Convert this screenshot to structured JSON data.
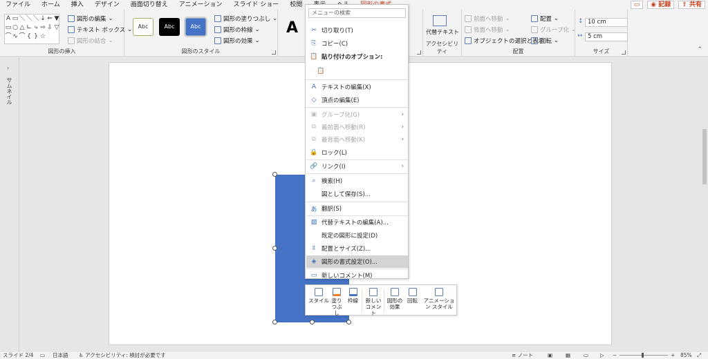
{
  "menubar": {
    "tabs": [
      "ファイル",
      "ホーム",
      "挿入",
      "デザイン",
      "画面切り替え",
      "アニメーション",
      "スライド ショー",
      "校閲",
      "表示",
      "ヘル",
      "図形の書式"
    ],
    "comment_icon": "comment-icon",
    "record": "記録",
    "share": "共有"
  },
  "ribbon": {
    "insert_shapes": {
      "shapes": [
        "A",
        "▭",
        "＼",
        "＼",
        "＼",
        "↓",
        "⇐",
        "▼",
        "▭",
        "○",
        "△",
        "∟",
        "⤷",
        "⇨",
        "⇩",
        "▽",
        "⌒",
        "∿",
        "⌒",
        "{",
        "}",
        "☆",
        "",
        ""
      ],
      "edit_shape": "図形の編集",
      "text_box": "テキスト ボックス",
      "merge_shapes": "図形の結合",
      "label": "図形の挿入"
    },
    "shape_styles": {
      "samples": [
        "Abc",
        "Abc",
        "Abc"
      ],
      "fill": "図形の塗りつぶし",
      "outline": "図形の枠線",
      "effects": "図形の効果",
      "label": "図形のスタイル"
    },
    "wordart": {
      "letter": "A"
    },
    "accessibility": {
      "alt_text": "代替テキスト",
      "label": "アクセシビリティ"
    },
    "arrange": {
      "bring_forward": "前面へ移動",
      "send_backward": "背面へ移動",
      "selection_pane": "オブジェクトの選択と表示",
      "align": "配置",
      "group": "グループ化",
      "rotate": "回転",
      "label": "配置"
    },
    "size": {
      "height": "10 cm",
      "width": "5 cm",
      "label": "サイズ"
    }
  },
  "thumbnails": {
    "label": "サムネイル",
    "toggle": "›"
  },
  "context_menu": {
    "search_placeholder": "メニューの検索",
    "items": [
      {
        "label": "切り取り(T)",
        "icon": "scissors-icon"
      },
      {
        "label": "コピー(C)",
        "icon": "copy-icon"
      },
      {
        "label": "貼り付けのオプション:",
        "icon": "paste-icon"
      },
      {
        "label": "",
        "icon": "paste-option-icon"
      },
      {
        "label": "テキストの編集(X)",
        "icon": "edit-text-icon"
      },
      {
        "label": "頂点の編集(E)",
        "icon": "edit-points-icon"
      },
      {
        "label": "グループ化(G)",
        "icon": "group-icon"
      },
      {
        "label": "最前面へ移動(R)",
        "icon": "bring-front-icon"
      },
      {
        "label": "最背面へ移動(K)",
        "icon": "send-back-icon"
      },
      {
        "label": "ロック(L)",
        "icon": "lock-icon"
      },
      {
        "label": "リンク(I)",
        "icon": "link-icon"
      },
      {
        "label": "検索(H)",
        "icon": "search-icon"
      },
      {
        "label": "図として保存(S)...",
        "icon": ""
      },
      {
        "label": "翻訳(S)",
        "icon": "translate-icon"
      },
      {
        "label": "代替テキストの編集(A)...",
        "icon": "alt-text-icon"
      },
      {
        "label": "既定の図形に設定(D)",
        "icon": ""
      },
      {
        "label": "配置とサイズ(Z)...",
        "icon": "size-position-icon"
      },
      {
        "label": "図形の書式設定(O)...",
        "icon": "format-shape-icon"
      },
      {
        "label": "新しいコメント(M)",
        "icon": "new-comment-icon"
      }
    ]
  },
  "mini_toolbar": {
    "style": "スタイル",
    "fill": "塗りつぶし",
    "outline": "枠線",
    "new_comment": "新しいコメント",
    "effects": "図形の効果",
    "rotate": "回転",
    "animation": "アニメーション スタイル"
  },
  "status": {
    "slide": "スライド 2/4",
    "language": "日本語",
    "accessibility": "アクセシビリティ: 検討が必要です",
    "notes": "ノート",
    "zoom": "85%"
  },
  "colors": {
    "accent": "#c43e1c",
    "shape_fill": "#4472c4"
  }
}
